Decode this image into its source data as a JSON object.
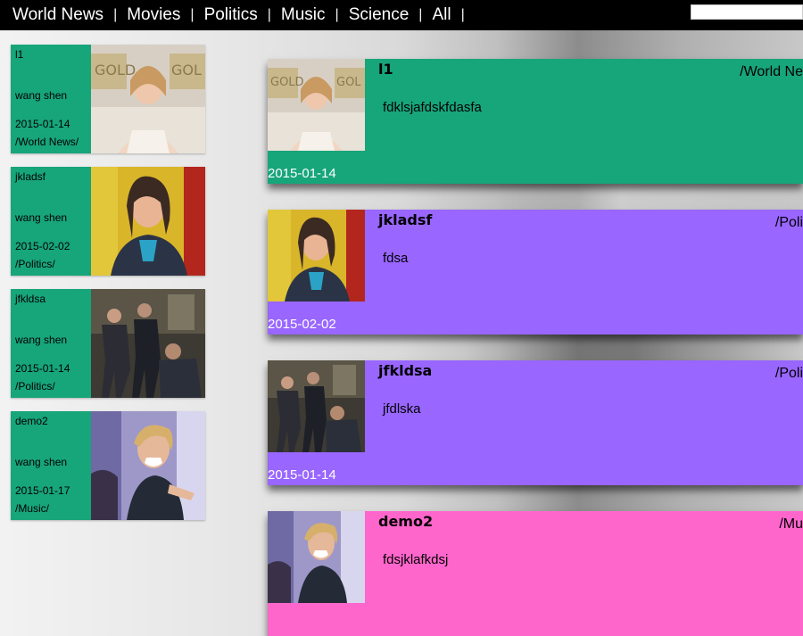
{
  "nav": {
    "items": [
      "World News",
      "Movies",
      "Politics",
      "Music",
      "Science",
      "All"
    ],
    "separator": "|"
  },
  "search": {
    "placeholder": ""
  },
  "colors": {
    "green": "#17a57a",
    "purple": "#9966ff",
    "pink": "#ff66cc",
    "topbar": "#000000"
  },
  "sidebar": {
    "items": [
      {
        "title": "l1",
        "author": "wang shen",
        "date": "2015-01-14",
        "category": "/World News/",
        "image": "golden-globes-woman-photo"
      },
      {
        "title": "jkladsf",
        "author": "wang shen",
        "date": "2015-02-02",
        "category": "/Politics/",
        "image": "woman-news-studio-photo"
      },
      {
        "title": "jfkldsa",
        "author": "wang shen",
        "date": "2015-01-14",
        "category": "/Politics/",
        "image": "action-fight-scene-photo"
      },
      {
        "title": "demo2",
        "author": "wang shen",
        "date": "2015-01-17",
        "category": "/Music/",
        "image": "smiling-young-man-photo"
      }
    ]
  },
  "feed": {
    "posts": [
      {
        "title": "l1",
        "category": "/World Ne",
        "body": "fdklsjafdskfdasfa",
        "date": "2015-01-14",
        "color": "#17a57a",
        "image": "golden-globes-woman-photo"
      },
      {
        "title": "jkladsf",
        "category": "/Poli",
        "body": "fdsa",
        "date": "2015-02-02",
        "color": "#9966ff",
        "image": "woman-news-studio-photo"
      },
      {
        "title": "jfkldsa",
        "category": "/Poli",
        "body": "jfdlska",
        "date": "2015-01-14",
        "color": "#9966ff",
        "image": "action-fight-scene-photo"
      },
      {
        "title": "demo2",
        "category": "/Mu",
        "body": "fdsjklafkdsj",
        "date": "",
        "color": "#ff66cc",
        "image": "smiling-young-man-photo"
      }
    ]
  }
}
